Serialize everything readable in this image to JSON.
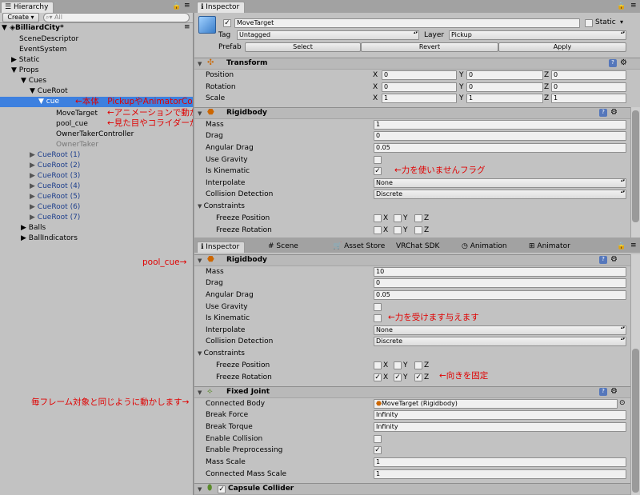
{
  "hierarchy": {
    "tab": "Hierarchy",
    "create_label": "Create",
    "search_placeholder": "All",
    "scene": "BilliardCity*",
    "items": [
      {
        "text": "SceneDescriptor"
      },
      {
        "text": "EventSystem"
      },
      {
        "text": "Static"
      },
      {
        "text": "Props"
      },
      {
        "text": "Cues"
      },
      {
        "text": "CueRoot"
      },
      {
        "text": "cue"
      },
      {
        "text": "MoveTarget"
      },
      {
        "text": "pool_cue"
      },
      {
        "text": "OwnerTakerController"
      },
      {
        "text": "OwnerTaker"
      },
      {
        "text": "CueRoot (1)"
      },
      {
        "text": "CueRoot (2)"
      },
      {
        "text": "CueRoot (3)"
      },
      {
        "text": "CueRoot (4)"
      },
      {
        "text": "CueRoot (5)"
      },
      {
        "text": "CueRoot (6)"
      },
      {
        "text": "CueRoot (7)"
      },
      {
        "text": "Balls"
      },
      {
        "text": "BallIndicators"
      }
    ]
  },
  "annotations": {
    "cue": "←本体　PickupやAnimatorControllerがついてる",
    "movetarget": "←アニメーションで動かす",
    "pool_cue": "←見た目やコライダーが入ってる",
    "kinematic1": "←力を使いませんフラグ",
    "pool_cue_label": "pool_cue→",
    "kinematic2": "←力を受けます与えます",
    "rotation_fixed": "←向きを固定",
    "fixed_joint": "毎フレーム対象と同じように動かします→"
  },
  "inspector_top": {
    "tab": "Inspector",
    "object_name": "MoveTarget",
    "static_label": "Static",
    "tag_label": "Tag",
    "tag_value": "Untagged",
    "layer_label": "Layer",
    "layer_value": "Pickup",
    "prefab_label": "Prefab",
    "select_label": "Select",
    "revert_label": "Revert",
    "apply_label": "Apply",
    "transform": {
      "title": "Transform",
      "position_label": "Position",
      "rotation_label": "Rotation",
      "scale_label": "Scale",
      "x": "X",
      "y": "Y",
      "z": "Z",
      "position": [
        "0",
        "0",
        "0"
      ],
      "rotation": [
        "0",
        "0",
        "0"
      ],
      "scale": [
        "1",
        "1",
        "1"
      ]
    },
    "rigidbody": {
      "title": "Rigidbody",
      "mass_label": "Mass",
      "mass": "1",
      "drag_label": "Drag",
      "drag": "0",
      "angular_drag_label": "Angular Drag",
      "angular_drag": "0.05",
      "use_gravity_label": "Use Gravity",
      "is_kinematic_label": "Is Kinematic",
      "interpolate_label": "Interpolate",
      "interpolate": "None",
      "collision_label": "Collision Detection",
      "collision": "Discrete",
      "constraints_label": "Constraints",
      "freeze_position_label": "Freeze Position",
      "freeze_rotation_label": "Freeze Rotation",
      "x": "X",
      "y": "Y",
      "z": "Z"
    }
  },
  "bottom_tabs": [
    "Inspector",
    "Scene",
    "Asset Store",
    "VRChat SDK",
    "Animation",
    "Animator"
  ],
  "inspector_bottom": {
    "rigidbody": {
      "title": "Rigidbody",
      "mass_label": "Mass",
      "mass": "10",
      "drag_label": "Drag",
      "drag": "0",
      "angular_drag_label": "Angular Drag",
      "angular_drag": "0.05",
      "use_gravity_label": "Use Gravity",
      "is_kinematic_label": "Is Kinematic",
      "interpolate_label": "Interpolate",
      "interpolate": "None",
      "collision_label": "Collision Detection",
      "collision": "Discrete",
      "constraints_label": "Constraints",
      "freeze_position_label": "Freeze Position",
      "freeze_rotation_label": "Freeze Rotation",
      "x": "X",
      "y": "Y",
      "z": "Z"
    },
    "fixed_joint": {
      "title": "Fixed Joint",
      "connected_body_label": "Connected Body",
      "connected_body": "MoveTarget (Rigidbody)",
      "break_force_label": "Break Force",
      "break_force": "Infinity",
      "break_torque_label": "Break Torque",
      "break_torque": "Infinity",
      "enable_collision_label": "Enable Collision",
      "enable_preprocessing_label": "Enable Preprocessing",
      "mass_scale_label": "Mass Scale",
      "mass_scale": "1",
      "connected_mass_scale_label": "Connected Mass Scale",
      "connected_mass_scale": "1"
    },
    "capsule_title": "Capsule Collider"
  },
  "colors": {
    "selection": "#3d80df",
    "annotation": "#e00000",
    "prefab_blue": "#1e3f8c"
  }
}
